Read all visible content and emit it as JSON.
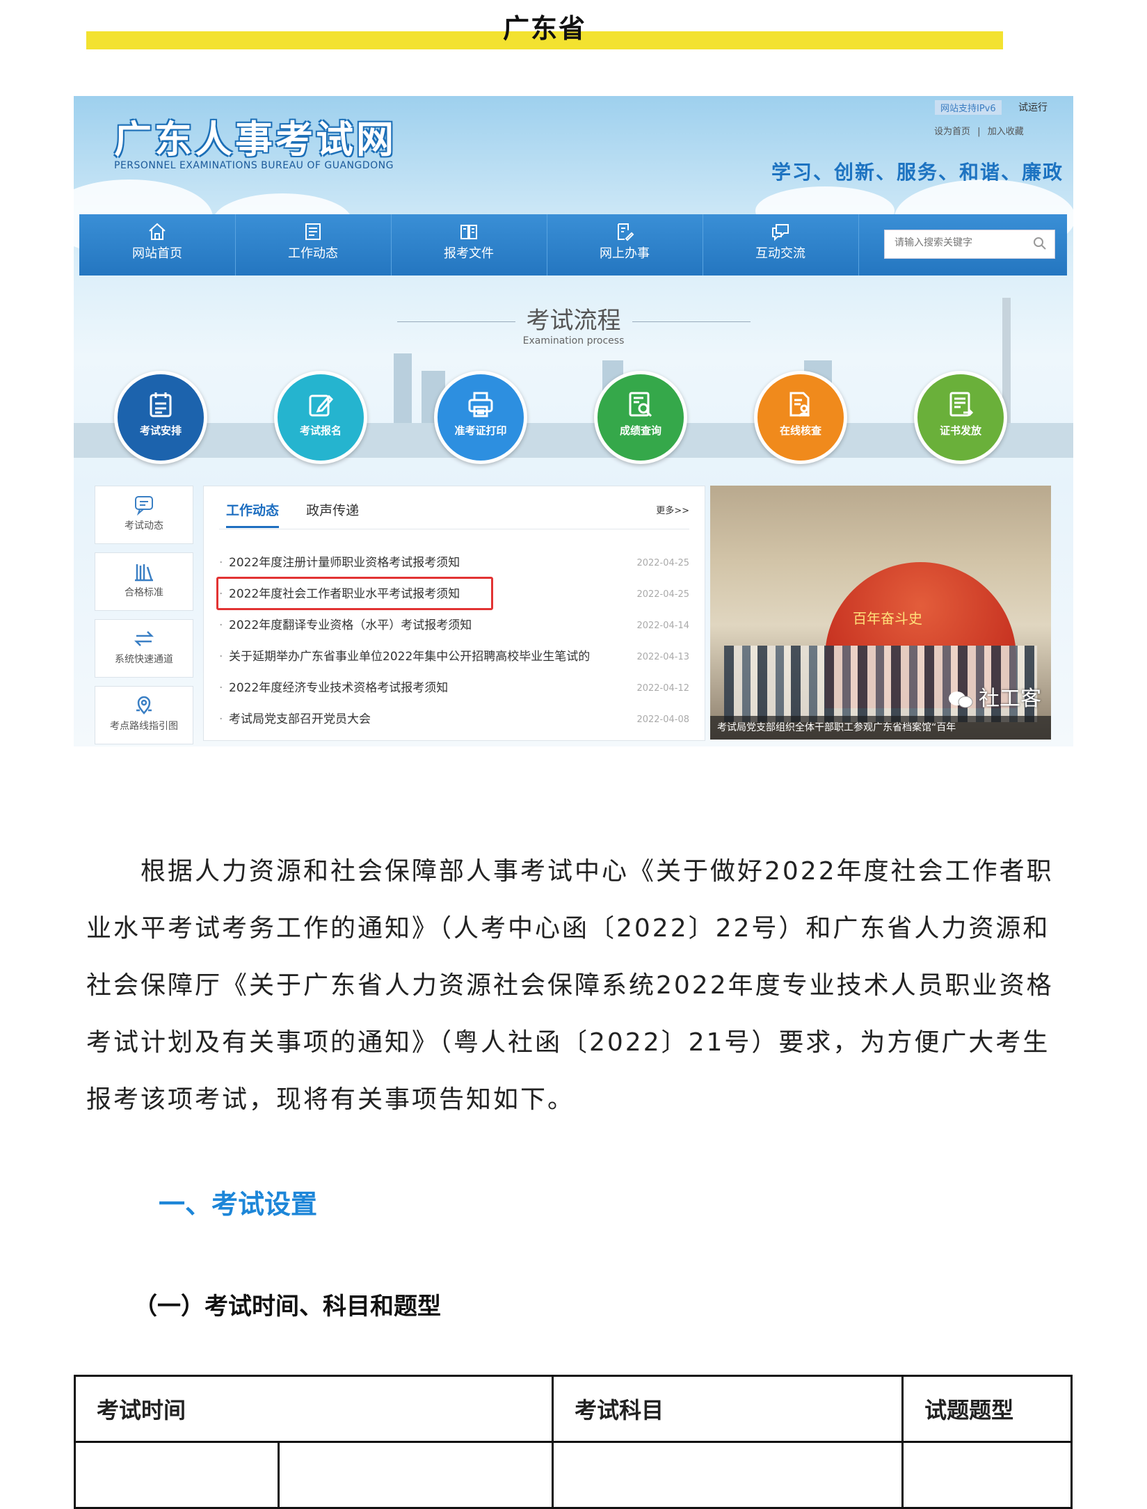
{
  "region_title": "广东省",
  "site": {
    "logo_cn": "广东人事考试网",
    "logo_en": "PERSONNEL EXAMINATIONS BUREAU OF GUANGDONG",
    "ipv6_badge": "网站支持IPv6",
    "trial_badge": "试运行",
    "top_links": [
      "设为首页",
      "|",
      "加入收藏"
    ],
    "slogan": "学习、创新、服务、和谐、廉政",
    "nav": [
      {
        "label": "网站首页",
        "icon": "home-icon"
      },
      {
        "label": "工作动态",
        "icon": "list-doc-icon"
      },
      {
        "label": "报考文件",
        "icon": "book-icon"
      },
      {
        "label": "网上办事",
        "icon": "edit-doc-icon"
      },
      {
        "label": "互动交流",
        "icon": "chat-icon"
      }
    ],
    "search_placeholder": "请输入搜索关键字",
    "process_title": "考试流程",
    "process_subtitle": "Examination process",
    "steps": [
      {
        "label": "考试安排",
        "color": "#1c63ad",
        "icon": "calendar-list-icon"
      },
      {
        "label": "考试报名",
        "color": "#25b4cf",
        "icon": "edit-icon"
      },
      {
        "label": "准考证打印",
        "color": "#2d8fe0",
        "icon": "printer-icon"
      },
      {
        "label": "成绩查询",
        "color": "#35a84a",
        "icon": "search-doc-icon"
      },
      {
        "label": "在线核查",
        "color": "#f08a1c",
        "icon": "user-doc-icon"
      },
      {
        "label": "证书发放",
        "color": "#6ab03a",
        "icon": "certificate-icon"
      }
    ],
    "side": [
      {
        "label": "考试动态",
        "icon": "message-icon"
      },
      {
        "label": "合格标准",
        "icon": "books-icon"
      },
      {
        "label": "系统快速通道",
        "icon": "swap-arrows-icon"
      },
      {
        "label": "考点路线指引图",
        "icon": "location-icon"
      }
    ],
    "news_tabs": [
      "工作动态",
      "政声传递"
    ],
    "news_more": "更多>>",
    "news": [
      {
        "title": "2022年度注册计量师职业资格考试报考须知",
        "date": "2022-04-25"
      },
      {
        "title": "2022年度社会工作者职业水平考试报考须知",
        "date": "2022-04-25"
      },
      {
        "title": "2022年度翻译专业资格（水平）考试报考须知",
        "date": "2022-04-14"
      },
      {
        "title": "关于延期举办广东省事业单位2022年集中公开招聘高校毕业生笔试的",
        "date": "2022-04-13"
      },
      {
        "title": "2022年度经济专业技术资格考试报考须知",
        "date": "2022-04-12"
      },
      {
        "title": "考试局党支部召开党员大会",
        "date": "2022-04-08"
      }
    ],
    "photo_caption": "考试局党支部组织全体干部职工参观广东省档案馆“百年",
    "photo_arch_text": "百年奋斗史",
    "watermark": "社工客"
  },
  "intro": "根据人力资源和社会保障部人事考试中心《关于做好2022年度社会工作者职业水平考试考务工作的通知》（人考中心函〔2022〕22号）和广东省人力资源和社会保障厅《关于广东省人力资源社会保障系统2022年度专业技术人员职业资格考试计划及有关事项的通知》（粤人社函〔2022〕21号）要求，为方便广大考生报考该项考试，现将有关事项告知如下。",
  "section_heading": "一、考试设置",
  "subsection_heading": "（一）考试时间、科目和题型",
  "table_headers": [
    "考试时间",
    "考试科目",
    "试题题型"
  ]
}
